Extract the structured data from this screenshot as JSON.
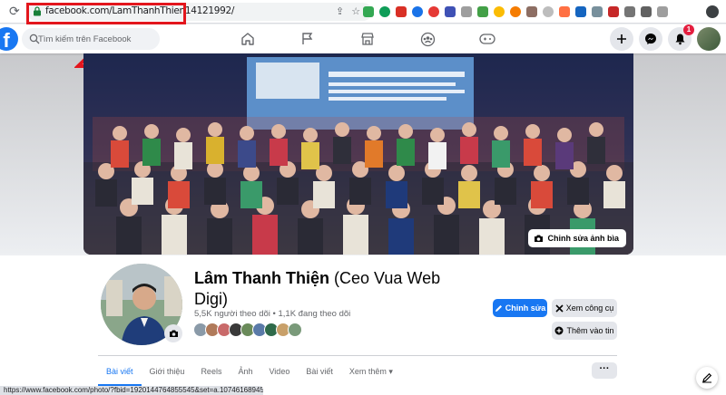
{
  "browser": {
    "url": "facebook.com/LamThanhThien14121992/"
  },
  "nav": {
    "logo": "f",
    "search_placeholder": "Tìm kiếm trên Facebook",
    "notification_count": "1"
  },
  "annotation": {
    "highlight_color": "#e3161d"
  },
  "cover": {
    "edit_label": "Chỉnh sửa ảnh bìa"
  },
  "profile": {
    "name": "Lâm Thanh Thiện",
    "name_suffix": "(Ceo Vua Web Digi)",
    "follow_stats": "5,5K người theo dõi • 1,1K đang theo dõi",
    "edit_button": "Chỉnh sửa",
    "tools_button": "Xem công cụ",
    "add_story_button": "Thêm vào tin"
  },
  "tabs": [
    {
      "label": "Bài viết"
    },
    {
      "label": "Giới thiệu"
    },
    {
      "label": "Reels"
    },
    {
      "label": "Ảnh"
    },
    {
      "label": "Video"
    },
    {
      "label": "Bài viết"
    },
    {
      "label": "Xem thêm ▾"
    }
  ],
  "more_button": "···",
  "status_bar": "https://www.facebook.com/photo/?fbid=1920144764855545&set=a.107461689457204",
  "colors": {
    "brand": "#1877f2",
    "badge": "#e41e3f"
  }
}
